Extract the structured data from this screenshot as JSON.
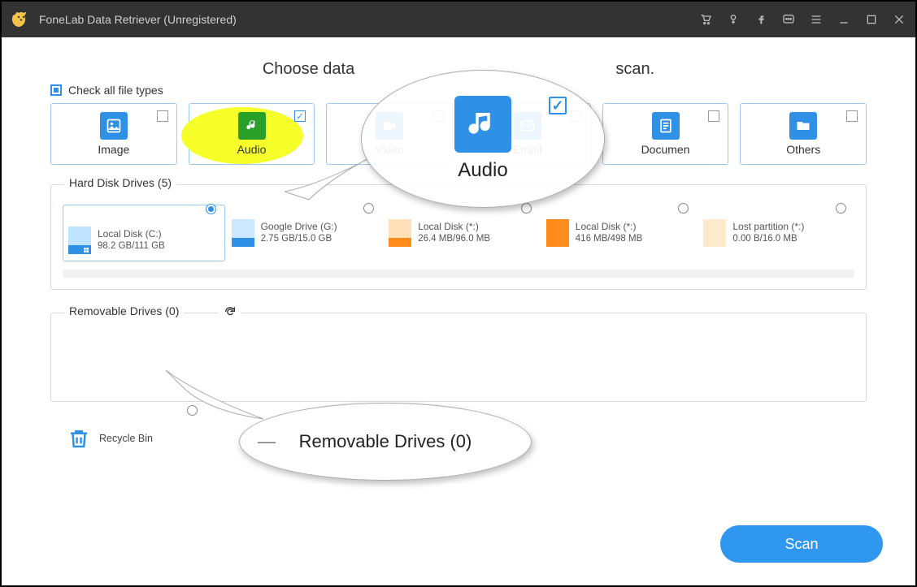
{
  "titlebar": {
    "app_title": "FoneLab Data Retriever (Unregistered)"
  },
  "heading_left": "Choose data",
  "heading_right": "scan.",
  "check_all_label": "Check all file types",
  "types": {
    "image": "Image",
    "audio": "Audio",
    "video": "Video",
    "email": "Email",
    "document": "Documen",
    "others": "Others"
  },
  "hard_disk": {
    "title": "Hard Disk Drives (5)",
    "drives": [
      {
        "name": "Local Disk (C:)",
        "size": "98.2 GB/111 GB",
        "top": "#BFE4FF",
        "bot": "#2F91E6"
      },
      {
        "name": "Google Drive (G:)",
        "size": "2.75 GB/15.0 GB",
        "top": "#CCE9FF",
        "bot": "#2F91E6"
      },
      {
        "name": "Local Disk (*:)",
        "size": "26.4 MB/96.0 MB",
        "top": "#FFE0B8",
        "bot": "#FF8C1A"
      },
      {
        "name": "Local Disk (*:)",
        "size": "416 MB/498 MB",
        "top": "#FF8C1A",
        "bot": "#FF8C1A"
      },
      {
        "name": "Lost partition (*:)",
        "size": "0.00  B/16.0 MB",
        "top": "#FFE9CC",
        "bot": "#FFE9CC"
      }
    ]
  },
  "removable": {
    "title": "Removable Drives (0)"
  },
  "recycle_label": "Recycle Bin",
  "scan_label": "Scan",
  "bubble_audio": "Audio",
  "bubble_removable": "Removable Drives (0)"
}
